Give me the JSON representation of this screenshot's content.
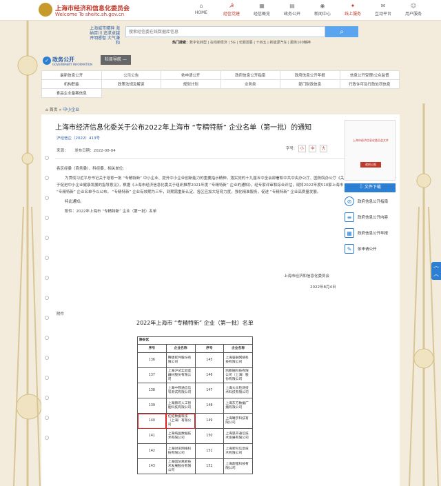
{
  "header": {
    "site_title": "上海市经济和信息化委员会",
    "site_subtitle": "Welcome To  sheitc.sh.gov.cn",
    "nav": [
      {
        "label": "HOME",
        "icon": "home-icon"
      },
      {
        "label": "经信党建",
        "icon": "party-icon"
      },
      {
        "label": "经信概览",
        "icon": "building-icon"
      },
      {
        "label": "政务公开",
        "icon": "doc-icon"
      },
      {
        "label": "新闻中心",
        "icon": "news-icon"
      },
      {
        "label": "线上服务",
        "icon": "service-icon"
      },
      {
        "label": "互动平台",
        "icon": "chat-icon"
      },
      {
        "label": "用户服务",
        "icon": "user-icon"
      }
    ],
    "active_nav": "经信党建",
    "accent_color": "#c0392b"
  },
  "search": {
    "slogan": "上海城市精神 海纳百川 追求卓越 开明睿智 大气谦和",
    "placeholder": "搜索经信委在线数据库信息",
    "hot_label": "热门搜索：",
    "hot_terms": "数字化转型 | 在线新经济 | 5G | 长期发展 | 十四五 | 新能源汽车 | 服务100精神"
  },
  "gov": {
    "title": "政务公开",
    "subtitle": "GOVERNMENT INFORMATION",
    "column_nav": "栏目导航  —"
  },
  "menu": [
    [
      "最新信息公开",
      "公示公告",
      "依申请公开",
      "政府信息公开指南",
      "政府信息公开年报",
      "信息公开受理/公众监督"
    ],
    [
      "机构职能",
      "政策法规及解读",
      "规划计划",
      "业务类",
      "部门财政信息",
      "行政许可及行政处罚信息"
    ],
    [
      "食品企业备案信息",
      "",
      "",
      "",
      "",
      ""
    ]
  ],
  "breadcrumb": {
    "home": "首页",
    "sep": "»",
    "current": "中小企业"
  },
  "article": {
    "title": "上海市经济信息化委关于公布2022年上海市 “专精特新” 企业名单（第一批）的通知",
    "doc_no": "沪经信企〔2022〕413号",
    "source": "来源：",
    "published": "发布日期：2022-08-04",
    "font_label": "字号:",
    "font_sizes": [
      "小",
      "中",
      "大"
    ],
    "greeting": "各区经委（商务委）、科经委，相关单位:",
    "paragraph": "为贯彻习近平总书记关于培育一批 “专精特新” 中小企业、提升中小企业创新能力的重要指示精神，落实党的十九届五中全会部署和中共中央办公厅、国务院办公厅《关于促进中小企业健康发展的指导意见》，根据《上海市经济信息化委关于组织推荐2021年度 “专精特新” 企业的通知》，经专家评审和综合评估，现将2022年度510家上海市 “专精特新” 企业名单予以公布。 “专精特新” 企业有效期为三年，到期需重新认定。各区应加大培育力度，强化精准服务，促进 “专精特新” 企业高质量发展。",
    "closing": "特此通知。",
    "attachment_line": "附件：2022年上海市 “专精特新” 企业（第一批）名单",
    "signature": "上海市经济和信息化委员会",
    "sign_date": "2022年8月4日",
    "attachment_label": "附件",
    "list_title": "2022年上海市 “专精特新” 企业（第一批）名单"
  },
  "table": {
    "district": "静安区",
    "headers": [
      "序号",
      "企业名称",
      "序号",
      "企业名称"
    ],
    "rows": [
      [
        "136",
        "腾捷软件股份有限公司",
        "145",
        "上海容融网络科技有限公司"
      ],
      [
        "137",
        "上海沪试实验室器材股份有限公司",
        "146",
        "凯鹏融科技有限公司（上海）股份有限公司"
      ],
      [
        "138",
        "上海中铁通信信号测试有限公司",
        "147",
        "上海大众检测技术科技有限公司"
      ],
      [
        "139",
        "上海赫司人工智能科技有限公司",
        "148",
        "上海东方数据广播有限公司"
      ],
      [
        "140",
        "任拓数据科技（上海）有限公司",
        "149",
        "上海曦宇科技有限公司"
      ],
      [
        "141",
        "上海纯晶数据技术有限公司",
        "150",
        "上海思声通信技术发展有限公司"
      ],
      [
        "142",
        "上海财讯网络科技有限公司",
        "151",
        "上海新科信息技术有限公司"
      ],
      [
        "143",
        "上海固坊离新技术发展股份有限公司",
        "152",
        "上海超锂科技有限公司"
      ]
    ],
    "highlight_color": "#e02020"
  },
  "sidebar": {
    "book_title": "上海市经济信息化委员会文件",
    "book_badge": "政府公报",
    "download": "文件下载",
    "links": [
      {
        "label": "政府信息公开指南",
        "icon": "compass-icon"
      },
      {
        "label": "政府信息公开内容",
        "icon": "list-icon"
      },
      {
        "label": "政府信息公开年报",
        "icon": "calendar-icon"
      },
      {
        "label": "依申请公开",
        "icon": "form-icon"
      }
    ]
  }
}
